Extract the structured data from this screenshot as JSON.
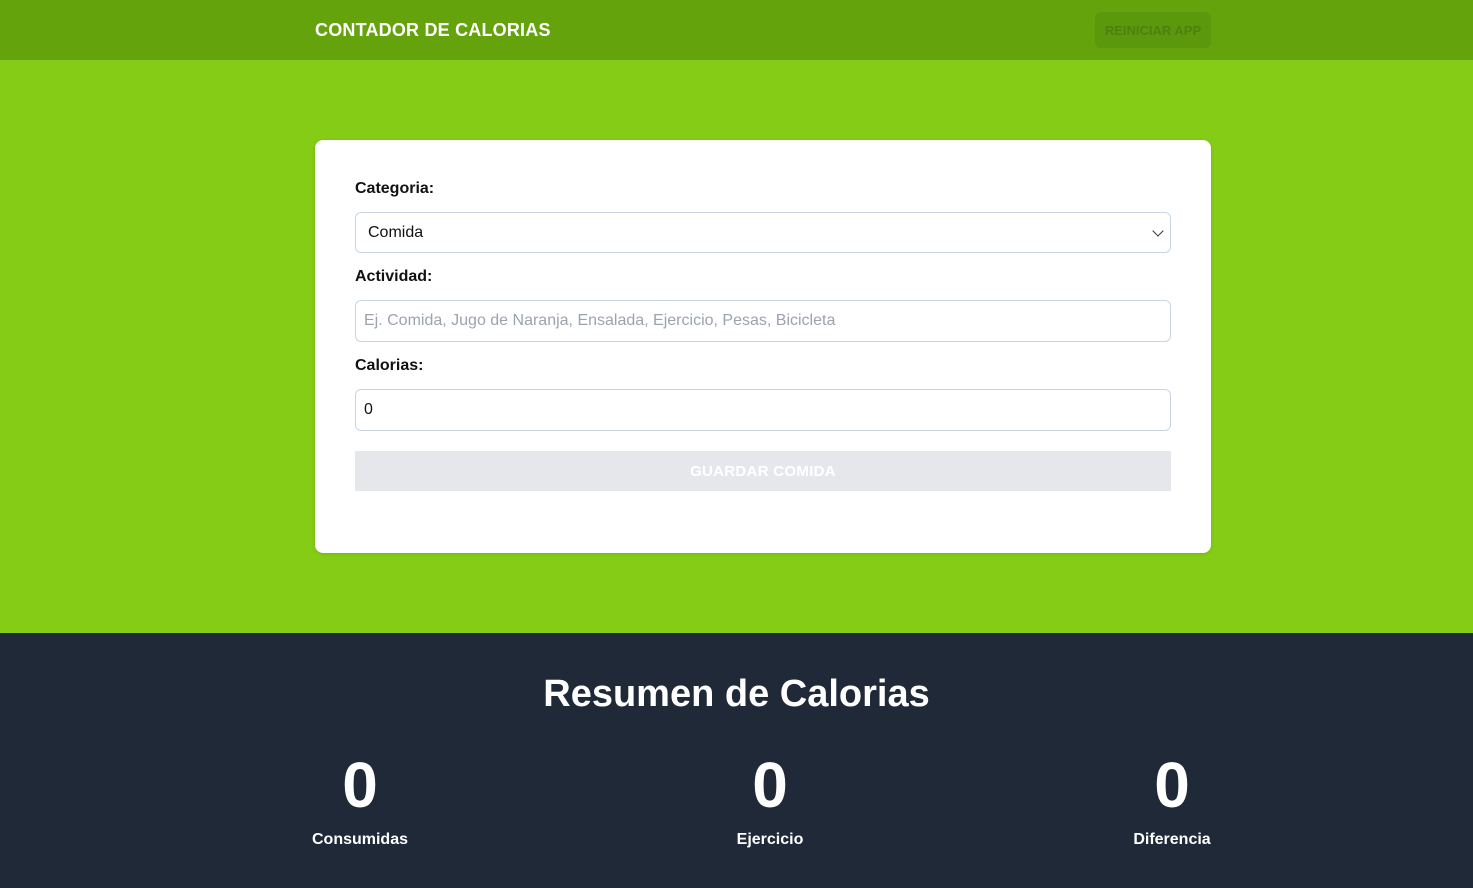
{
  "header": {
    "title": "CONTADOR DE CALORIAS",
    "reset_label": "REINICIAR APP"
  },
  "form": {
    "category_label": "Categoria:",
    "category_value": "Comida",
    "activity_label": "Actividad:",
    "activity_placeholder": "Ej. Comida, Jugo de Naranja, Ensalada, Ejercicio, Pesas, Bicicleta",
    "activity_value": "",
    "calories_label": "Calorias:",
    "calories_value": "0",
    "submit_label": "GUARDAR COMIDA"
  },
  "summary": {
    "title": "Resumen de Calorias",
    "stats": [
      {
        "value": "0",
        "label": "Consumidas"
      },
      {
        "value": "0",
        "label": "Ejercicio"
      },
      {
        "value": "0",
        "label": "Diferencia"
      }
    ]
  },
  "colors": {
    "header_bg": "#65a30d",
    "hero_bg": "#84cc16",
    "summary_bg": "#1f2937",
    "disabled_button_bg": "#e5e7eb"
  },
  "icons": {
    "select_arrow": "chevron-down-icon"
  }
}
